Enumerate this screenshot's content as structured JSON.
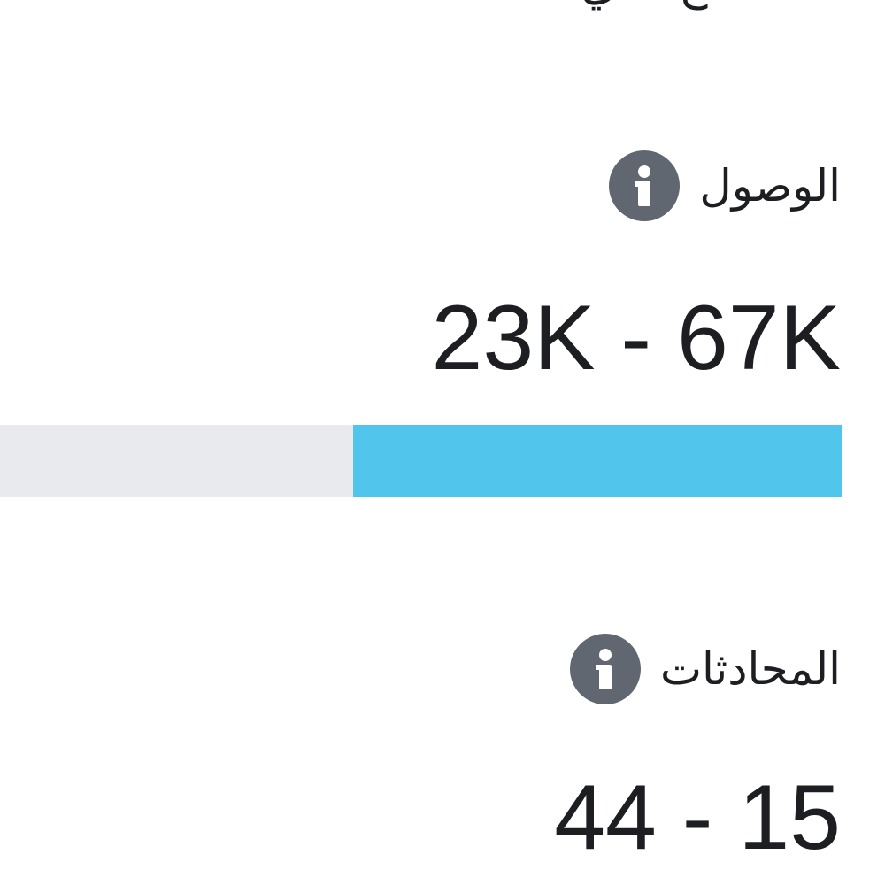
{
  "top_cropped_text": "ع ... ي",
  "metrics": [
    {
      "label": "الوصول",
      "value": "23K - 67K",
      "icon": "info-icon",
      "progress_fraction": 0.58
    },
    {
      "label": "المحادثات",
      "value": "44 - 15",
      "icon": "info-icon"
    }
  ],
  "colors": {
    "progress_fill": "#51c5ec",
    "progress_track": "#e9eaee",
    "icon_bg": "#606770",
    "text": "#1c1e21"
  }
}
